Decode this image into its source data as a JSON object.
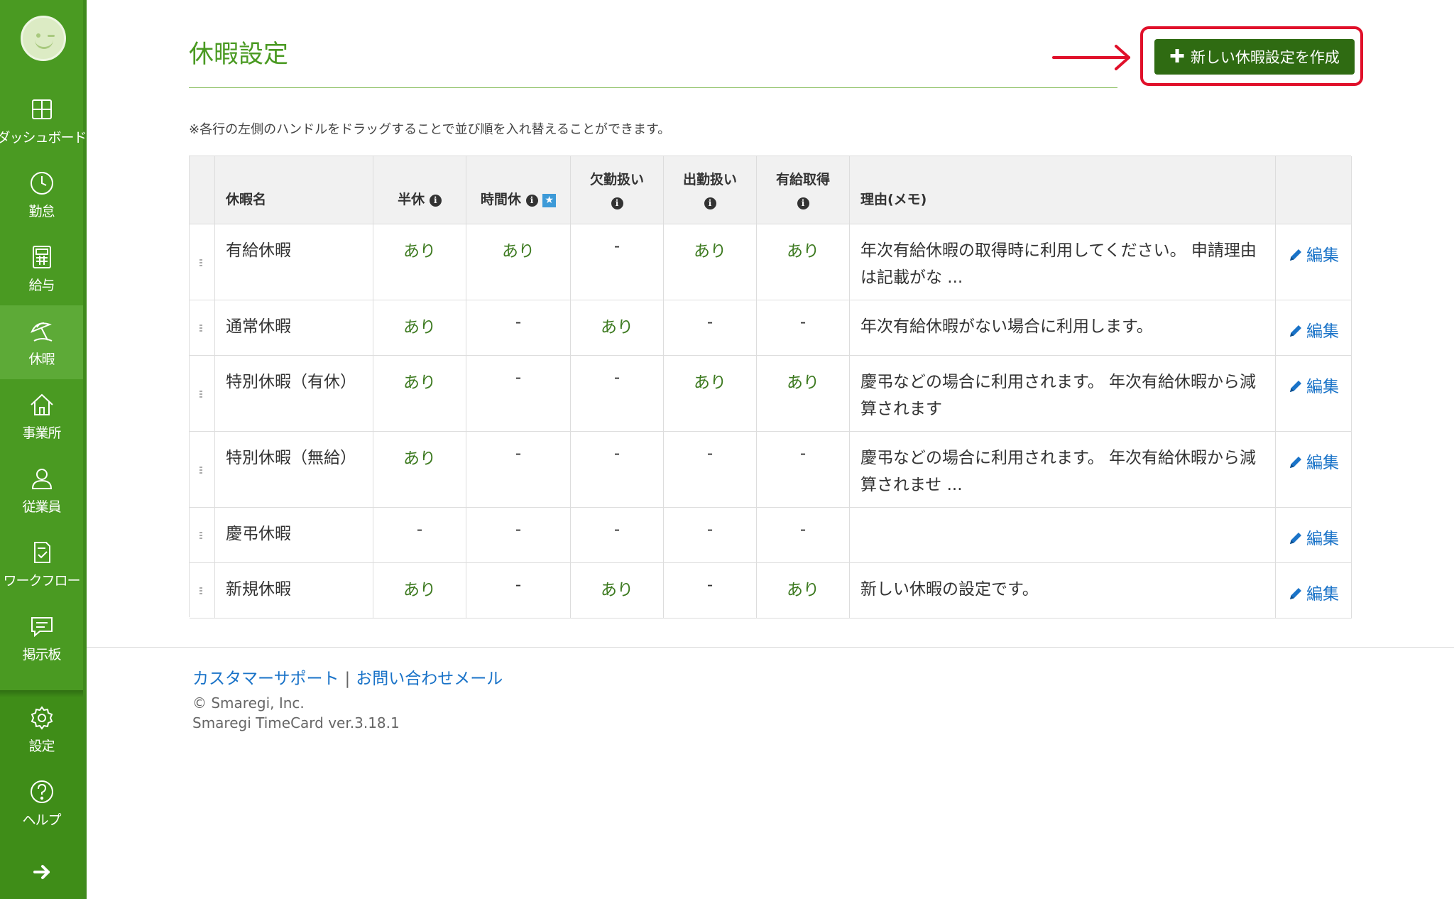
{
  "sidebar": {
    "items": [
      {
        "label": "ダッシュボード",
        "icon": "dashboard-icon"
      },
      {
        "label": "勤怠",
        "icon": "clock-icon"
      },
      {
        "label": "給与",
        "icon": "calculator-icon"
      },
      {
        "label": "休暇",
        "icon": "beach-umbrella-icon",
        "active": true
      },
      {
        "label": "事業所",
        "icon": "home-icon"
      },
      {
        "label": "従業員",
        "icon": "person-icon"
      },
      {
        "label": "ワークフロー",
        "icon": "checklist-icon"
      },
      {
        "label": "掲示板",
        "icon": "chat-icon"
      }
    ],
    "bottom": [
      {
        "label": "設定",
        "icon": "gear-icon"
      },
      {
        "label": "ヘルプ",
        "icon": "help-icon"
      }
    ],
    "accent": "#4a9a22"
  },
  "header": {
    "title": "休暇設定",
    "create_button": "新しい休暇設定を作成"
  },
  "note": "※各行の左側のハンドルをドラッグすることで並び順を入れ替えることができます。",
  "table": {
    "columns": {
      "name": "休暇名",
      "half": "半休",
      "hourly": "時間休",
      "absence_1": "欠勤扱",
      "absence_2": "い",
      "attendance_1": "出勤扱",
      "attendance_2": "い",
      "paid_1": "有給取",
      "paid_2": "得",
      "memo": "理由(メモ)"
    },
    "edit_label": "編集",
    "rows": [
      {
        "name": "有給休暇",
        "half": "あり",
        "hourly": "あり",
        "absence": "-",
        "attendance": "あり",
        "paid": "あり",
        "memo": "年次有給休暇の取得時に利用してください。 申請理由は記載がな ..."
      },
      {
        "name": "通常休暇",
        "half": "あり",
        "hourly": "-",
        "absence": "あり",
        "attendance": "-",
        "paid": "-",
        "memo": "年次有給休暇がない場合に利用します。"
      },
      {
        "name": "特別休暇（有休）",
        "half": "あり",
        "hourly": "-",
        "absence": "-",
        "attendance": "あり",
        "paid": "あり",
        "memo": "慶弔などの場合に利用されます。 年次有給休暇から減算されます"
      },
      {
        "name": "特別休暇（無給）",
        "half": "あり",
        "hourly": "-",
        "absence": "-",
        "attendance": "-",
        "paid": "-",
        "memo": "慶弔などの場合に利用されます。 年次有給休暇から減算されませ ..."
      },
      {
        "name": "慶弔休暇",
        "half": "-",
        "hourly": "-",
        "absence": "-",
        "attendance": "-",
        "paid": "-",
        "memo": ""
      },
      {
        "name": "新規休暇",
        "half": "あり",
        "hourly": "-",
        "absence": "あり",
        "attendance": "-",
        "paid": "あり",
        "memo": "新しい休暇の設定です。"
      }
    ]
  },
  "footer": {
    "support_link": "カスタマーサポート",
    "separator": "|",
    "mail_link": "お問い合わせメール",
    "copyright": "© Smaregi, Inc.",
    "version": "Smaregi TimeCard ver.3.18.1"
  }
}
